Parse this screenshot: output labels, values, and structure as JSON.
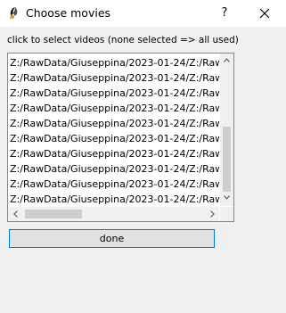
{
  "window": {
    "title": "Choose movies",
    "help_label": "?"
  },
  "hint": "click to select videos (none selected => all used)",
  "list": {
    "items": [
      "Z:/RawData/Giuseppina/2023-01-24/Z:/RawD",
      "Z:/RawData/Giuseppina/2023-01-24/Z:/RawD",
      "Z:/RawData/Giuseppina/2023-01-24/Z:/RawD",
      "Z:/RawData/Giuseppina/2023-01-24/Z:/RawD",
      "Z:/RawData/Giuseppina/2023-01-24/Z:/RawD",
      "Z:/RawData/Giuseppina/2023-01-24/Z:/RawD",
      "Z:/RawData/Giuseppina/2023-01-24/Z:/RawD",
      "Z:/RawData/Giuseppina/2023-01-24/Z:/RawD",
      "Z:/RawData/Giuseppina/2023-01-24/Z:/RawD",
      "Z:/RawData/Giuseppina/2023-01-24/Z:/RawD"
    ]
  },
  "done_label": "done",
  "colors": {
    "focus_border": "#0078d7",
    "scroll_thumb": "#cdcdcd"
  },
  "icons": {
    "app": "python-feather-icon",
    "close": "close-icon",
    "scroll_up": "chevron-up-icon",
    "scroll_down": "chevron-down-icon",
    "scroll_left": "chevron-left-icon",
    "scroll_right": "chevron-right-icon"
  }
}
